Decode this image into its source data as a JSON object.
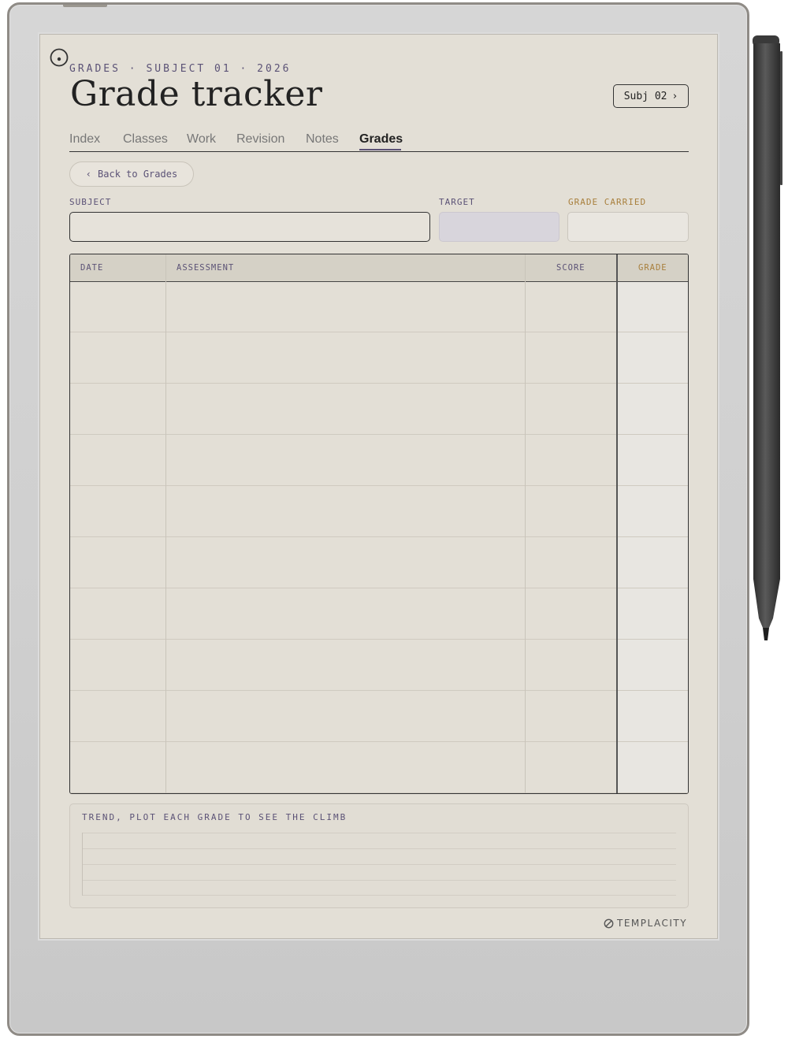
{
  "header": {
    "eyebrow": "GRADES · SUBJECT 01 · 2026",
    "title": "Grade tracker",
    "next_subject_label": "Subj 02",
    "next_chevron": "›"
  },
  "tabs": [
    {
      "label": "Index",
      "active": false
    },
    {
      "label": "Classes",
      "active": false
    },
    {
      "label": "Work",
      "active": false
    },
    {
      "label": "Revision",
      "active": false
    },
    {
      "label": "Notes",
      "active": false
    },
    {
      "label": "Grades",
      "active": true
    }
  ],
  "back": {
    "chevron": "‹",
    "label": "Back to Grades"
  },
  "fields": {
    "subject": {
      "label": "SUBJECT",
      "value": ""
    },
    "target": {
      "label": "TARGET",
      "value": ""
    },
    "grade_carried": {
      "label": "GRADE CARRIED",
      "value": ""
    }
  },
  "table": {
    "headers": [
      "DATE",
      "ASSESSMENT",
      "SCORE",
      "GRADE"
    ],
    "rows": [
      [
        "",
        "",
        "",
        ""
      ],
      [
        "",
        "",
        "",
        ""
      ],
      [
        "",
        "",
        "",
        ""
      ],
      [
        "",
        "",
        "",
        ""
      ],
      [
        "",
        "",
        "",
        ""
      ],
      [
        "",
        "",
        "",
        ""
      ],
      [
        "",
        "",
        "",
        ""
      ],
      [
        "",
        "",
        "",
        ""
      ],
      [
        "",
        "",
        "",
        ""
      ],
      [
        "",
        "",
        "",
        ""
      ]
    ]
  },
  "trend": {
    "label": "TREND, PLOT EACH GRADE TO SEE THE CLIMB"
  },
  "brand": {
    "name": "TEMPLACITY"
  },
  "colors": {
    "accent_purple": "#5b5276",
    "accent_gold": "#a87f3c",
    "paper": "#e3dfd6",
    "ink": "#222222"
  },
  "icons": {
    "power": "power-icon",
    "brand_logo": "templacity-logo-icon",
    "stylus": "stylus-pen"
  }
}
